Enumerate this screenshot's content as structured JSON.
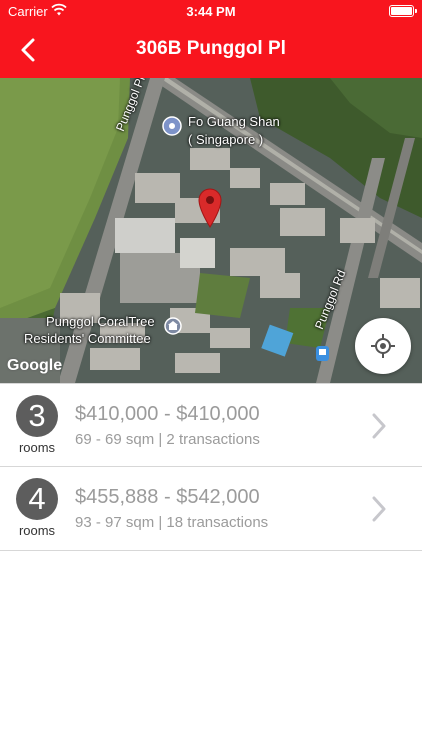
{
  "status_bar": {
    "carrier": "Carrier",
    "time": "3:44 PM"
  },
  "nav": {
    "title": "306B Punggol Pl",
    "back_icon": "chevron-left-icon",
    "background": "#f8151e"
  },
  "map": {
    "labels": {
      "road_punggol_pl": "Punggol Pl",
      "road_punggol_rd": "Punggol Rd",
      "fo_guang_shan_line1": "Fo Guang Shan",
      "fo_guang_shan_line2": "( Singapore )",
      "coraltree_line1": "Punggol CoralTree",
      "coraltree_line2": "Residents' Committee"
    },
    "attribution": "Google",
    "marker_color": "#d92a2a"
  },
  "listings": [
    {
      "rooms": "3",
      "rooms_label": "rooms",
      "price_range": "$410,000 - $410,000",
      "details": "69 - 69 sqm | 2 transactions"
    },
    {
      "rooms": "4",
      "rooms_label": "rooms",
      "price_range": "$455,888 - $542,000",
      "details": "93 - 97 sqm | 18 transactions"
    }
  ]
}
